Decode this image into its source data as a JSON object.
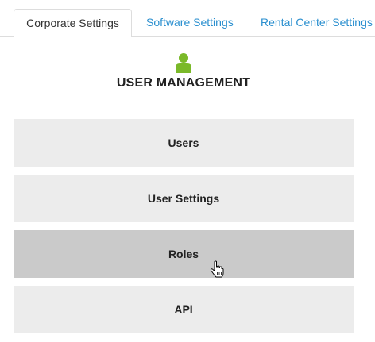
{
  "tabs": [
    {
      "label": "Corporate Settings",
      "active": true
    },
    {
      "label": "Software Settings",
      "active": false
    },
    {
      "label": "Rental Center Settings",
      "active": false
    }
  ],
  "section": {
    "icon": "user-icon",
    "title": "USER MANAGEMENT"
  },
  "menu": [
    {
      "label": "Users"
    },
    {
      "label": "User Settings"
    },
    {
      "label": "Roles",
      "hovered": true
    },
    {
      "label": "API"
    }
  ],
  "colors": {
    "accent_icon": "#7ab929",
    "link": "#2a8fcf",
    "button_bg": "#ececec",
    "button_hover_bg": "#cacaca"
  }
}
